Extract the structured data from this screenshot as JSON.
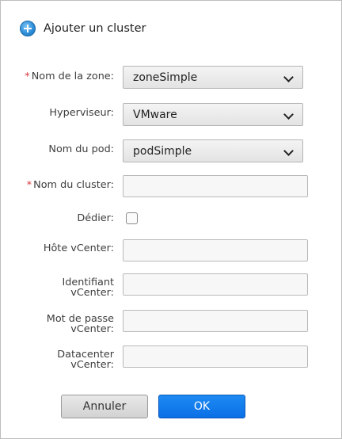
{
  "header": {
    "title": "Ajouter un cluster",
    "icon": "add-circle-icon"
  },
  "form": {
    "zone": {
      "label": "Nom de la zone:",
      "required_mark": "*",
      "value": "zoneSimple"
    },
    "hypervisor": {
      "label": "Hyperviseur:",
      "value": "VMware"
    },
    "pod": {
      "label": "Nom du pod:",
      "value": "podSimple"
    },
    "cluster_name": {
      "label": "Nom du cluster:",
      "required_mark": "*",
      "value": ""
    },
    "dedicate": {
      "label": "Dédier:",
      "checked": false
    },
    "vcenter_host": {
      "label": "Hôte vCenter:",
      "value": ""
    },
    "vcenter_id": {
      "label_line1": "Identifiant",
      "label_line2": "vCenter:",
      "value": ""
    },
    "vcenter_password": {
      "label_line1": "Mot de passe",
      "label_line2": "vCenter:",
      "value": ""
    },
    "vcenter_datacenter": {
      "label_line1": "Datacenter",
      "label_line2": "vCenter:",
      "value": ""
    }
  },
  "buttons": {
    "cancel": "Annuler",
    "ok": "OK"
  },
  "colors": {
    "ok_button": "#0b6fe6",
    "required": "#d9343a"
  }
}
